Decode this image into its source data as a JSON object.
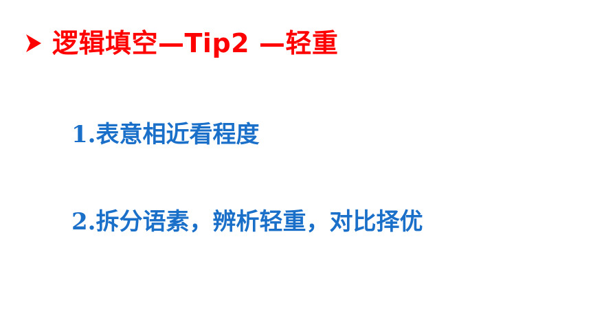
{
  "slide": {
    "title": "逻辑填空—Tip2 —轻重",
    "bullet_icon": "arrow-bullet-icon",
    "points": [
      {
        "number": "1.",
        "text": "表意相近看程度"
      },
      {
        "number": "2.",
        "text": "拆分语素，辨析轻重，对比择优"
      }
    ],
    "colors": {
      "title": "#ff0000",
      "bullet": "#ff0000",
      "points": "#1a6fc9",
      "background": "#ffffff"
    }
  }
}
